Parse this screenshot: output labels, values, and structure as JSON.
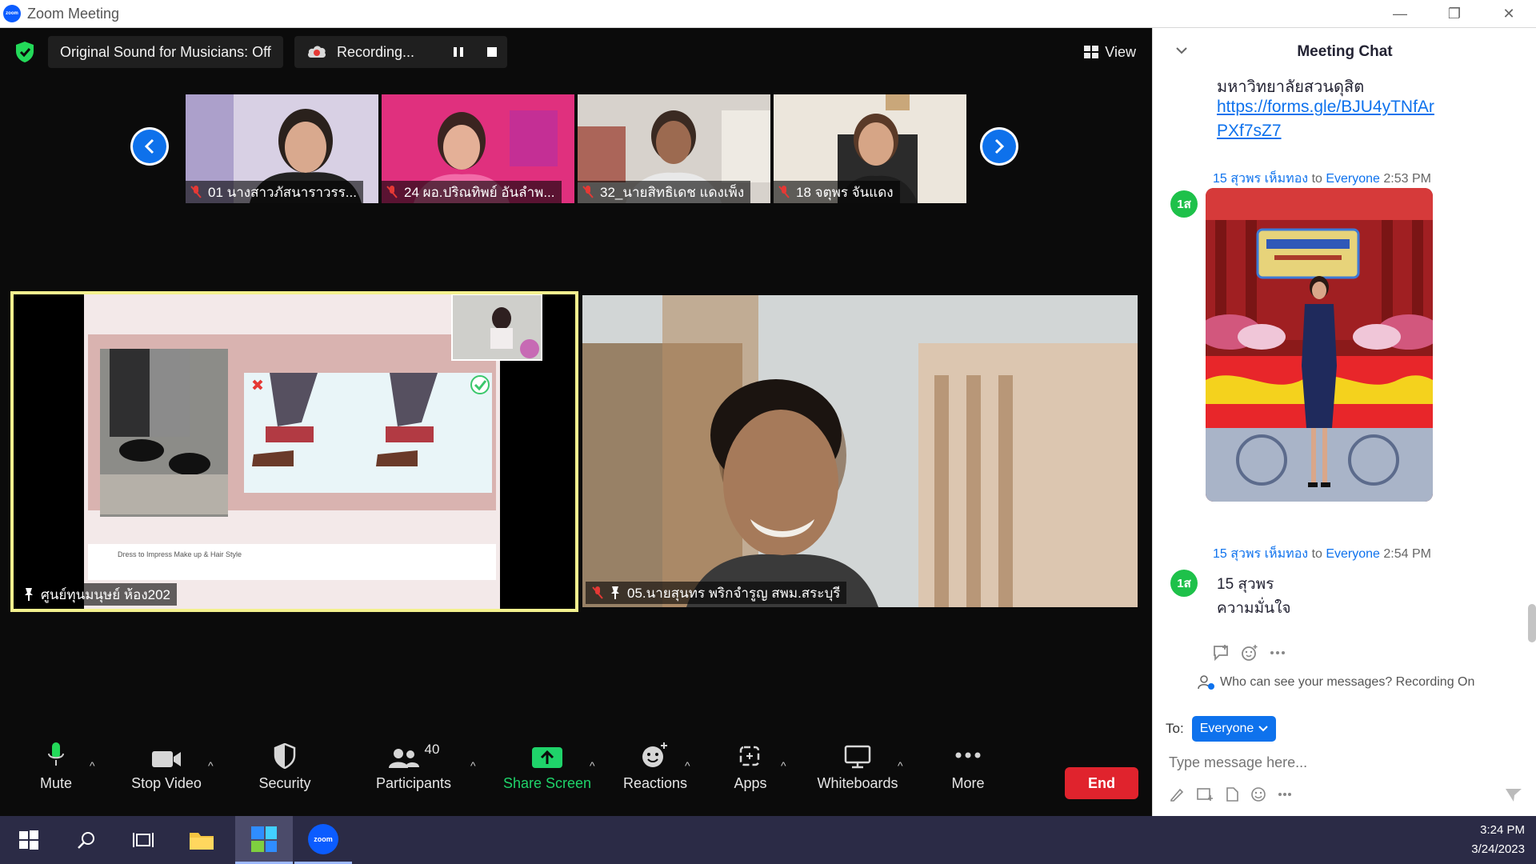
{
  "window": {
    "title": "Zoom Meeting"
  },
  "topbar": {
    "original_sound": "Original Sound for Musicians: Off",
    "recording": "Recording...",
    "view": "View"
  },
  "strip": [
    {
      "name": "01 นางสาวภัสนาราวรร..."
    },
    {
      "name": "24 ผอ.ปริณทิพย์ อันลำพ..."
    },
    {
      "name": "32_นายสิทธิเดช แดงเพ็ง"
    },
    {
      "name": "18 จตุพร จันแดง"
    }
  ],
  "main_tiles": [
    {
      "name": "ศูนย์ทุนมนุษย์ ห้อง202",
      "slide_caption": "Dress to Impress Make up & Hair Style"
    },
    {
      "name": "05.นายสุนทร พริกจำรูญ สพม.สระบุรี"
    }
  ],
  "toolbar": {
    "mute": "Mute",
    "stop_video": "Stop Video",
    "security": "Security",
    "participants": "Participants",
    "participants_count": "40",
    "share_screen": "Share Screen",
    "reactions": "Reactions",
    "apps": "Apps",
    "whiteboards": "Whiteboards",
    "more": "More",
    "end": "End"
  },
  "chat": {
    "title": "Meeting Chat",
    "partial_text": "มหาวิทยาลัยสวนดุสิต",
    "link_line1": "https://forms.gle/BJU4yTNfAr",
    "link_line2": "PXf7sZ7",
    "messages": [
      {
        "avatar": "1ส",
        "sender": "15 สุวพร เห็มทอง",
        "to": "to",
        "recipient": "Everyone",
        "time": "2:53 PM"
      },
      {
        "avatar": "1ส",
        "sender": "15 สุวพร เห็มทอง",
        "to": "to",
        "recipient": "Everyone",
        "time": "2:54 PM",
        "line1": "15 สุวพร",
        "line2": "ความมั่นใจ"
      }
    ],
    "privacy": "Who can see your messages? Recording On",
    "to_label": "To:",
    "to_value": "Everyone",
    "input_placeholder": "Type message here..."
  },
  "taskbar": {
    "time": "3:24 PM",
    "date": "3/24/2023",
    "zoom_label": "zoom"
  },
  "colors": {
    "accent": "#0e72ed",
    "share_green": "#1fd36a",
    "end_red": "#e0232d",
    "active_border": "#f4f18e"
  }
}
